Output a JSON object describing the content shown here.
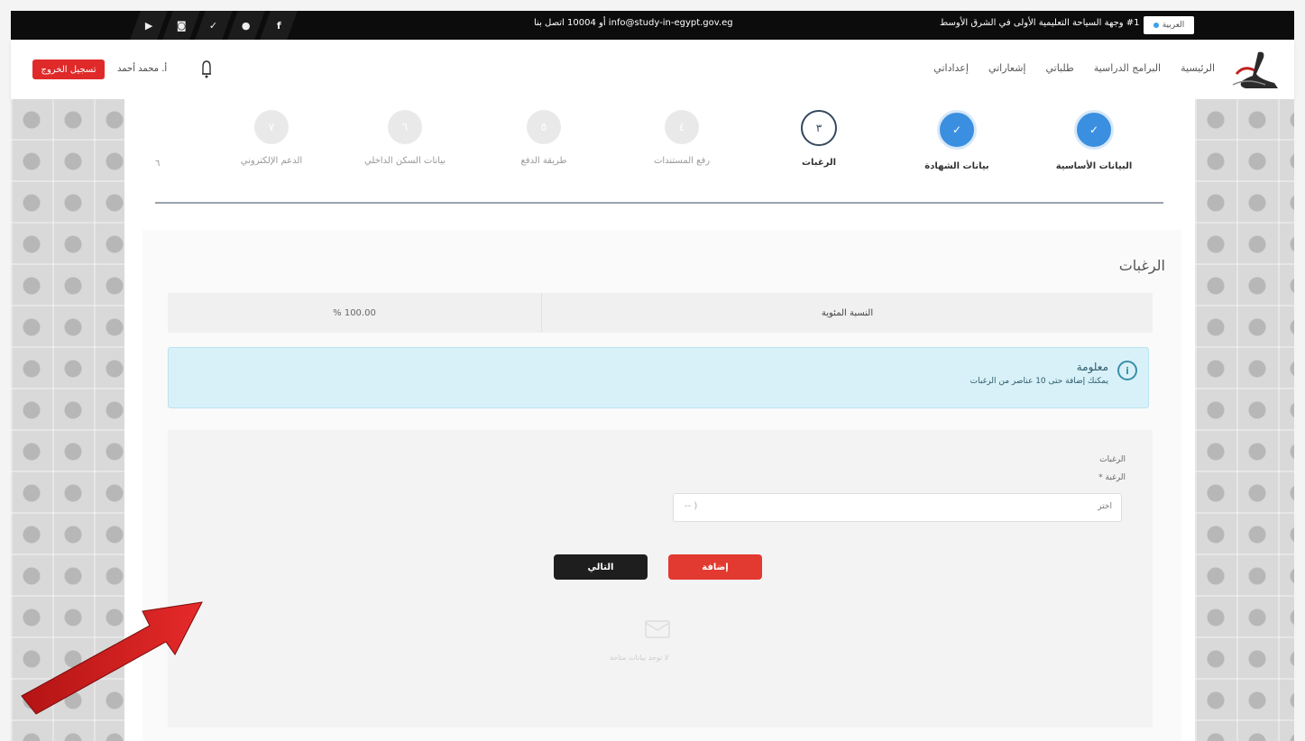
{
  "topbar": {
    "social_icons": [
      "video-icon",
      "instagram-icon",
      "twitter-icon",
      "linkedin-icon",
      "facebook-icon"
    ],
    "social_glyphs": [
      "▶",
      "◙",
      "✓",
      "●",
      "f"
    ],
    "contact": "info@study-in-egypt.gov.eg أو 10004 اتصل بنا",
    "tagline": "#1 وجهة السياحة التعليمية الأولى في الشرق الأوسط",
    "lang_label": "العربية"
  },
  "navbar": {
    "login_label": "تسجيل الخروج",
    "user_name": "أ. محمد أحمد",
    "links": [
      "الرئيسية",
      "البرامج الدراسية",
      "طلباتي",
      "إشعاراتي",
      "إعداداتي"
    ]
  },
  "stepper": {
    "steps": [
      {
        "label": "البيانات الأساسية",
        "state": "done",
        "mark": "✓"
      },
      {
        "label": "بيانات الشهادة",
        "state": "done",
        "mark": "✓"
      },
      {
        "label": "الرغبات",
        "state": "current",
        "mark": "٣"
      },
      {
        "label": "رفع المستندات",
        "state": "todo",
        "mark": "٤"
      },
      {
        "label": "طريقة الدفع",
        "state": "todo",
        "mark": "٥"
      },
      {
        "label": "بيانات السكن الداخلي",
        "state": "todo",
        "mark": "٦"
      },
      {
        "label": "الدعم الإلكتروني",
        "state": "todo",
        "mark": "٧"
      }
    ],
    "index_marker": "٦"
  },
  "section": {
    "title": "الرغبات",
    "percent_label": "النسبة المئوية",
    "percent_value": "% 100.00",
    "info_title": "معلومة",
    "info_text": "يمكنك إضافة حتى 10 عناصر من الرغبات",
    "form_heading": "الرغبات",
    "field_label": "الرغبة *",
    "select_value": "اختر",
    "select_placeholder": "-- )",
    "add_label": "إضافة",
    "next_label": "التالي",
    "empty_text": "لا توجد بيانات متاحة"
  },
  "colors": {
    "accent_red": "#e23a30",
    "step_done": "#3b8fe0",
    "info_bg": "#d8f1f8"
  }
}
